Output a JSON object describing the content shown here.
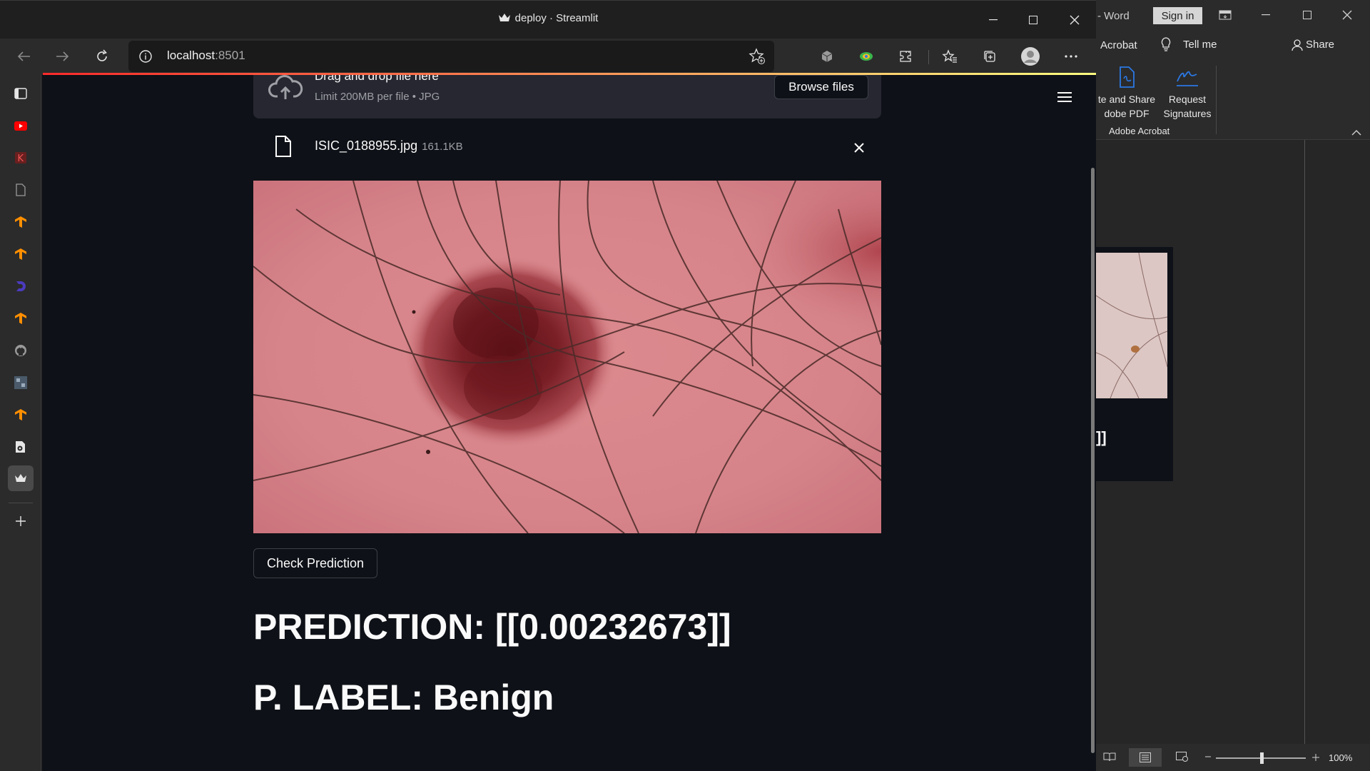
{
  "browser": {
    "window_title": "deploy · Streamlit",
    "address": {
      "host": "localhost",
      "port": ":8501"
    }
  },
  "uploader": {
    "drop_text": "Drag and drop file here",
    "limit_text": "Limit 200MB per file • JPG",
    "browse_label": "Browse files",
    "file_name": "ISIC_0188955.jpg",
    "file_size": "161.1KB"
  },
  "actions": {
    "check_label": "Check Prediction"
  },
  "results": {
    "prediction": "PREDICTION: [[0.00232673]]",
    "label": "P. LABEL: Benign"
  },
  "word": {
    "app_name": "- Word",
    "sign_in": "Sign in",
    "menu_acrobat": "Acrobat",
    "menu_tellme": "Tell me",
    "menu_share": "Share",
    "ribbon_create_line1": "te and Share",
    "ribbon_create_line2": "dobe PDF",
    "ribbon_request_line1": "Request",
    "ribbon_request_line2": "Signatures",
    "ribbon_group": "Adobe Acrobat",
    "doc_fragment": "]]",
    "zoom": "100%"
  },
  "colors": {
    "page_bg": "#0e1117",
    "accent": "#ff4b4b",
    "word_accent": "#2b78e4"
  }
}
